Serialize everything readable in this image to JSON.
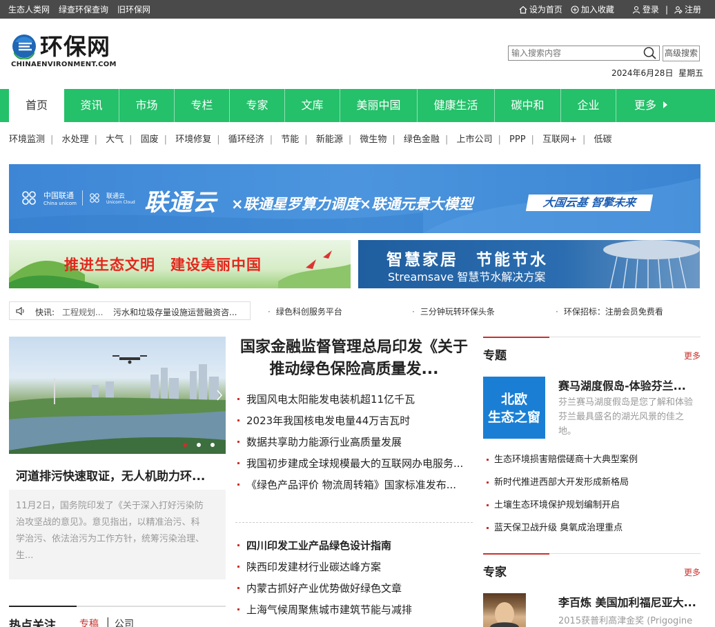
{
  "topbar": {
    "links": [
      "生态人类网",
      "绿查环保查询",
      "旧环保网"
    ],
    "set_home": "设为首页",
    "favorite": "加入收藏",
    "login": "登录",
    "sep": "|",
    "register": "注册"
  },
  "header": {
    "logo_text": "环保网",
    "logo_sub": "CHINAENVIRONMENT.COM",
    "search_placeholder": "输入搜索内容",
    "advanced_search": "高级搜索",
    "date": "2024年6月28日",
    "weekday": "星期五"
  },
  "nav": {
    "items": [
      "首页",
      "资讯",
      "市场",
      "专栏",
      "专家",
      "文库",
      "美丽中国",
      "健康生活",
      "碳中和",
      "企业"
    ],
    "more": "更多"
  },
  "subnav": [
    "环境监测",
    "水处理",
    "大气",
    "固废",
    "环境修复",
    "循环经济",
    "节能",
    "新能源",
    "微生物",
    "绿色金融",
    "上市公司",
    "PPP",
    "互联网+",
    "低碳"
  ],
  "subnav_sep": "|",
  "banners": {
    "unicom_logo1": "中国联通",
    "unicom_logo1_en": "China unicom",
    "unicom_logo2": "联通云",
    "unicom_logo2_en": "Unicom Cloud",
    "unicom_main": "联通云",
    "unicom_rest": "×联通星罗算力调度×联通元景大模型",
    "unicom_tag": "大国云基 智擎未来",
    "eco_text": "推进生态文明　建设美丽中国",
    "water_t1": "智慧家居　节能节水",
    "water_t2": "Streamsave 智慧节水解决方案"
  },
  "ticker": {
    "label": "快讯:",
    "item1": "工程规划...",
    "item2": "污水和垃圾存量设施运营融资咨..."
  },
  "quicklinks": [
    "绿色科创服务平台",
    "三分钟玩转环保头条",
    "环保招标：注册会员免费看"
  ],
  "photo": {
    "title": "河道排污快速取证，无人机助力环...",
    "desc": [
      "11月2日，国务院印发了《关于深入打好污染防",
      "治攻坚战的意见》。意见指出，以精准治污、科",
      "学治污、依法治污为工作方针，统筹污染治理、",
      "生..."
    ]
  },
  "hot": {
    "title": "热点关注",
    "tab1": "专稿",
    "sep": "|",
    "tab2": "公司"
  },
  "center": {
    "headline": "国家金融监督管理总局印发《关于推动绿色保险高质量发...",
    "list1": [
      "我国风电太阳能发电装机超11亿千瓦",
      "2023年我国核电发电量44万吉瓦时",
      "数据共享助力能源行业高质量发展",
      "我国初步建成全球规模最大的互联网办电服务...",
      "《绿色产品评价 物流周转箱》国家标准发布..."
    ],
    "list2_lead": "四川印发工业产品绿色设计指南",
    "list2": [
      "陕西印发建材行业碳达峰方案",
      "内蒙古抓好产业优势做好绿色文章",
      "上海气候周聚焦城市建筑节能与减排"
    ]
  },
  "topics": {
    "title": "专题",
    "more": "更多",
    "tile_text": [
      "北欧",
      "生态之窗"
    ],
    "feature_title": "赛马湖度假岛-体验芬兰...",
    "feature_desc": "芬兰赛马湖度假岛是您了解和体验芬兰最具盛名的湖光风景的佳之地。",
    "items": [
      "生态环境损害赔偿磋商十大典型案例",
      "新时代推进西部大开发形成新格局",
      "土壤生态环境保护规划编制开启",
      "蓝天保卫战升级 臭氧成治理重点"
    ]
  },
  "experts": {
    "title": "专家",
    "more": "更多",
    "name": "李百炼 美国加利福尼亚大...",
    "desc": "2015获普利高津金奖 (Prigogine"
  },
  "colors": {
    "nav_green": "#25c06a",
    "accent_red": "#c9302c",
    "topbar": "#4a4a4a"
  }
}
